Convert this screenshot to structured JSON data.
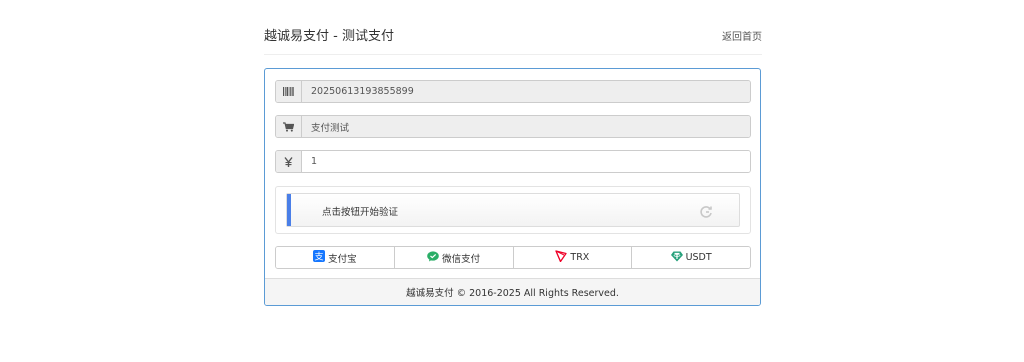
{
  "header": {
    "title": "越诚易支付 - 测试支付",
    "home_link": "返回首页"
  },
  "form": {
    "order_no": "20250613193855899",
    "product_name": "支付测试",
    "amount": "1",
    "order_icon": "barcode-icon",
    "product_icon": "cart-icon",
    "amount_icon": "yen-icon"
  },
  "captcha": {
    "label": "点击按钮开始验证",
    "icon": "refresh-icon",
    "accent_color": "#4a7fe8"
  },
  "payment_methods": [
    {
      "label": "支付宝",
      "icon": "alipay-icon",
      "color": "#1677ff"
    },
    {
      "label": "微信支付",
      "icon": "wechat-icon",
      "color": "#2aae67"
    },
    {
      "label": "TRX",
      "icon": "tron-icon",
      "color": "#ef0027"
    },
    {
      "label": "USDT",
      "icon": "tether-icon",
      "color": "#26a17b"
    }
  ],
  "footer": {
    "copyright": "越诚易支付 © 2016-2025 All Rights Reserved."
  }
}
